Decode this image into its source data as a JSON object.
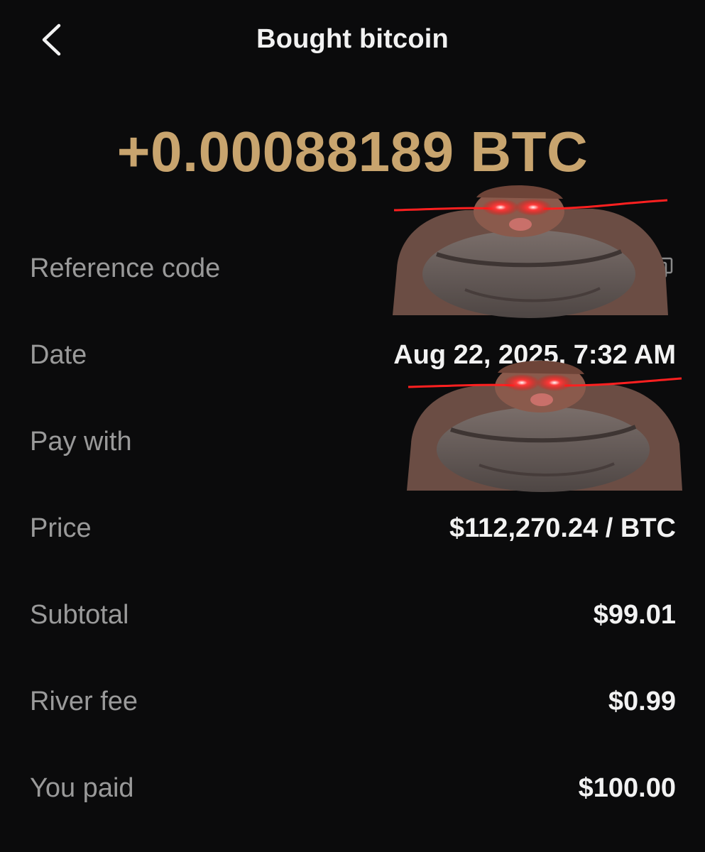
{
  "header": {
    "title": "Bought bitcoin",
    "back_icon": "chevron-left-icon"
  },
  "amount": {
    "text": "+0.00088189 BTC",
    "color": "#c8a46e"
  },
  "details": [
    {
      "label": "Reference code",
      "value": ""
    },
    {
      "label": "Date",
      "value": "Aug 22, 2025, 7:32 AM"
    },
    {
      "label": "Pay with",
      "value": ""
    },
    {
      "label": "Price",
      "value": "$112,270.24 / BTC"
    },
    {
      "label": "Subtotal",
      "value": "$99.01"
    },
    {
      "label": "River fee",
      "value": "$0.99"
    },
    {
      "label": "You paid",
      "value": "$100.00"
    }
  ],
  "icons": {
    "copy": "copy-icon"
  },
  "stickers": [
    {
      "name": "laser-eyes-monkey-sticker"
    },
    {
      "name": "laser-eyes-monkey-sticker"
    }
  ]
}
